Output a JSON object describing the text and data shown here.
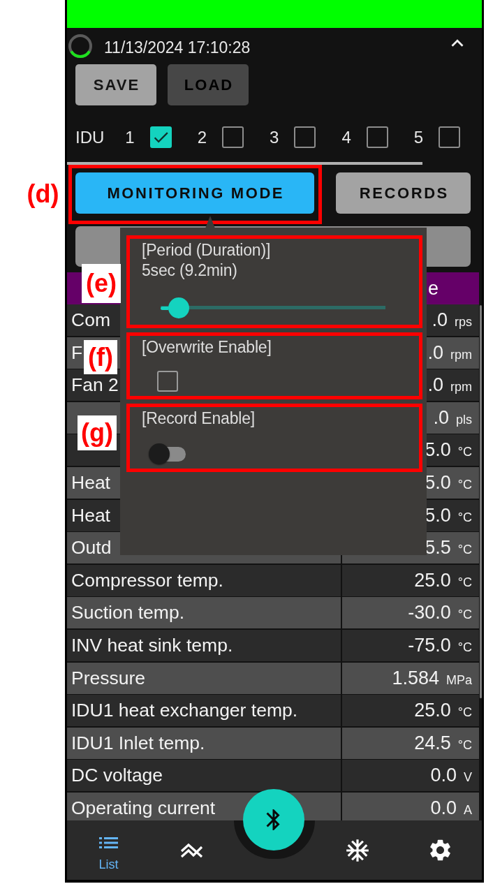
{
  "header": {
    "timestamp": "11/13/2024 17:10:28"
  },
  "file_buttons": [
    {
      "label": "SAVE",
      "disabled": false
    },
    {
      "label": "LOAD",
      "disabled": true
    }
  ],
  "idu": {
    "label": "IDU",
    "units": [
      {
        "number": "1",
        "checked": true
      },
      {
        "number": "2",
        "checked": false
      },
      {
        "number": "3",
        "checked": false
      },
      {
        "number": "4",
        "checked": false
      },
      {
        "number": "5",
        "checked": false
      }
    ]
  },
  "mode_buttons": [
    {
      "label": "MONITORING MODE",
      "selected": true
    },
    {
      "label": "RECORDS",
      "selected": false
    }
  ],
  "table": {
    "header": {
      "column_2": "e"
    },
    "rows": [
      {
        "label": "Com",
        "value": ".0",
        "unit": "rps"
      },
      {
        "label": "F",
        "value": ".0",
        "unit": "rpm"
      },
      {
        "label": "Fan 2",
        "value": ".0",
        "unit": "rpm"
      },
      {
        "value": ".0",
        "unit": "pls"
      },
      {
        "value": "5.0",
        "unit": "°C"
      },
      {
        "label": "Heat",
        "value": "5.0",
        "unit": "°C"
      },
      {
        "label": "Heat",
        "value": "5.0",
        "unit": "°C"
      },
      {
        "label": "Outd",
        "value": "5.5",
        "unit": "°C"
      },
      {
        "label": "Compressor temp.",
        "value": "25.0",
        "unit": "°C"
      },
      {
        "label": "Suction temp.",
        "value": "-30.0",
        "unit": "°C"
      },
      {
        "label": "INV heat sink temp.",
        "value": "-75.0",
        "unit": "°C"
      },
      {
        "label": "Pressure",
        "value": "1.584",
        "unit": "MPa"
      },
      {
        "label": "IDU1 heat exchanger temp.",
        "value": "25.0",
        "unit": "°C"
      },
      {
        "label": "IDU1 Inlet temp.",
        "value": "24.5",
        "unit": "°C"
      },
      {
        "label": "DC voltage",
        "value": "0.0",
        "unit": "V"
      },
      {
        "label": "Operating current",
        "value": "0.0",
        "unit": "A"
      }
    ]
  },
  "monitoring_popup": {
    "period": {
      "label": "[Period (Duration)]",
      "value": "5sec (9.2min)",
      "level": 0.08
    },
    "overwrite": {
      "label": "[Overwrite Enable]",
      "checked": false
    },
    "record": {
      "label": "[Record Enable]",
      "on": false
    }
  },
  "bottom_nav": {
    "items": [
      {
        "label": "List",
        "selected": true
      },
      {
        "selected": false
      },
      {
        "selected": false
      },
      {
        "selected": false
      }
    ]
  },
  "annotations": [
    {
      "label": "(d)"
    },
    {
      "label": "(e)"
    },
    {
      "label": "(f)"
    },
    {
      "label": "(g)"
    }
  ]
}
